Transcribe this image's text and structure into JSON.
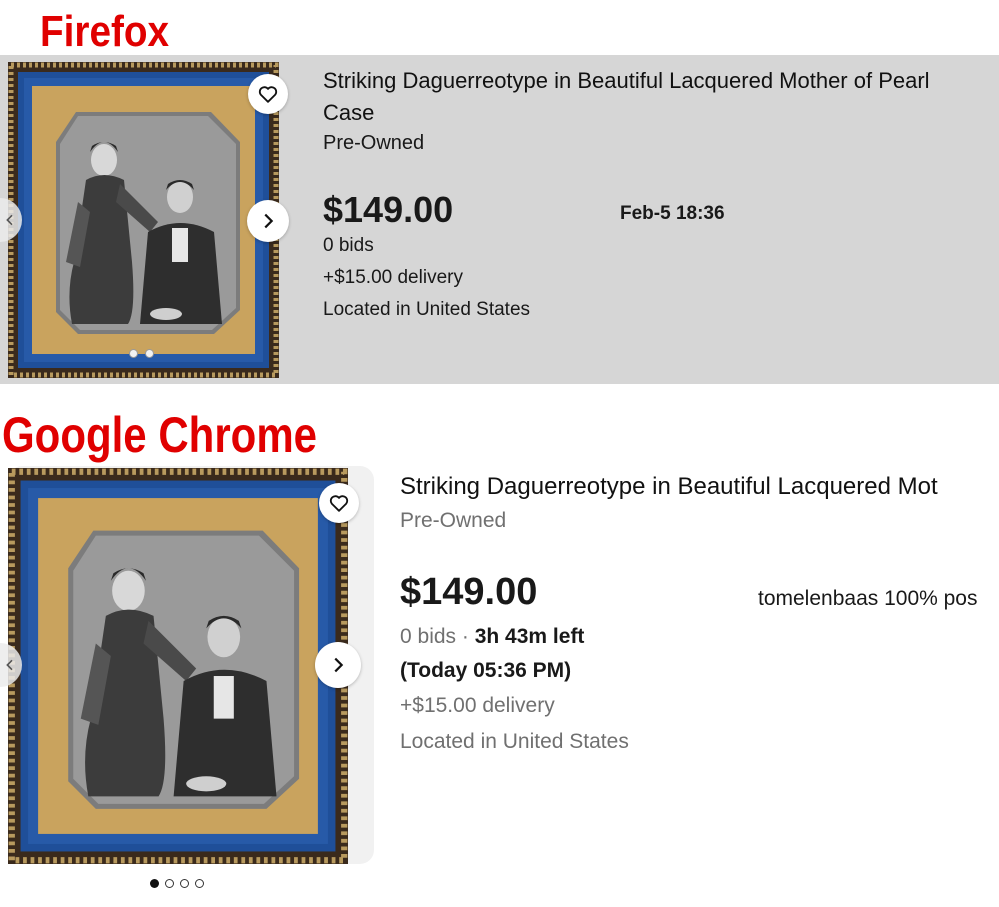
{
  "headings": {
    "firefox": "Firefox",
    "chrome": "Google Chrome"
  },
  "firefox": {
    "title_line1": "Striking Daguerreotype in Beautiful Lacquered Mother of Pearl",
    "title_line2": "Case",
    "condition": "Pre-Owned",
    "price": "$149.00",
    "end_time": "Feb-5 18:36",
    "bids": "0 bids",
    "delivery": "+$15.00 delivery",
    "location": "Located in United States",
    "image_dots": 2
  },
  "chrome": {
    "title": "Striking Daguerreotype in Beautiful Lacquered Mot",
    "condition": "Pre-Owned",
    "price": "$149.00",
    "seller": "tomelenbaas 100% pos",
    "bids": "0 bids",
    "bids_separator": " · ",
    "time_left": "3h 43m left",
    "end_time": "(Today 05:36 PM)",
    "delivery": "+$15.00 delivery",
    "location": "Located in United States",
    "image_dots": 4,
    "active_dot": 1
  },
  "icons": {
    "watch": "heart-icon",
    "next": "chevron-right-icon",
    "prev": "chevron-left-icon"
  },
  "colors": {
    "heading_red": "#e00000",
    "panel_gray": "#d6d6d6",
    "text_dark": "#191919",
    "text_gray": "#707070",
    "frame_blue": "#1f4f99",
    "mat_gold": "#c9a35e"
  }
}
